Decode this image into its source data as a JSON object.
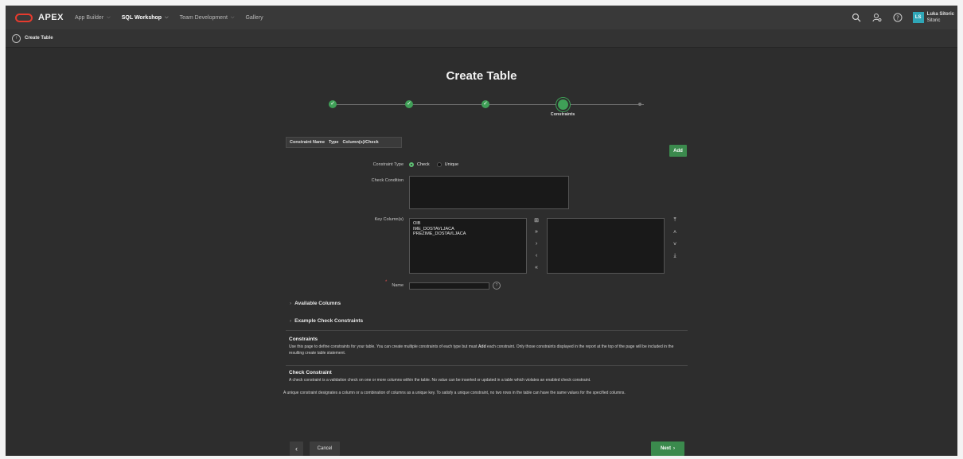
{
  "header": {
    "logo": "APEX",
    "nav": [
      {
        "label": "App Builder",
        "has_menu": true
      },
      {
        "label": "SQL Workshop",
        "has_menu": true
      },
      {
        "label": "Team Development",
        "has_menu": true
      },
      {
        "label": "Gallery",
        "has_menu": false
      }
    ],
    "icons": [
      "search-icon",
      "administration-icon",
      "help-icon"
    ],
    "user": {
      "initials": "LS",
      "first": "Luka Sitoric",
      "second": "Sitoric"
    }
  },
  "breadcrumb": {
    "label": "Create Table"
  },
  "page_title": "Create Table",
  "wizard": {
    "steps_done": 3,
    "current_label": "Constraints"
  },
  "report": {
    "columns": [
      "Constraint Name",
      "Type",
      "Column(s)/Check"
    ]
  },
  "buttons": {
    "add": "Add",
    "cancel": "Cancel",
    "next": "Next",
    "prev_icon": "‹",
    "next_icon": "›"
  },
  "form": {
    "constraint_type_label": "Constraint Type",
    "constraint_type_options": [
      "Check",
      "Unique"
    ],
    "constraint_type_selected": "Check",
    "check_condition_label": "Check Condition",
    "check_condition_value": "",
    "key_columns_label": "Key Column(s)",
    "available_columns": [
      "OIB",
      "IME_DOSTAVLJACA",
      "PREZIME_DOSTAVLJACA"
    ],
    "selected_columns": [],
    "name_label": "Name",
    "name_value": ""
  },
  "sections": {
    "available_columns": "Available Columns",
    "example_check": "Example Check Constraints"
  },
  "help": {
    "constraints_title": "Constraints",
    "constraints_text_before": "Use this page to define constraints for your table. You can create multiple constraints of each type but must ",
    "constraints_text_bold": "Add",
    "constraints_text_after": " each constraint. Only those constraints displayed in the report at the top of the page will be included in the resulting create table statement.",
    "check_title": "Check Constraint",
    "check_text": "A check constraint is a validation check on one or more columns within the table. No value can be inserted or updated in a table which violates an enabled check constraint.",
    "unique_text": "A unique constraint designates a column or a combination of columns as a unique key. To satisfy a unique constraint, no two rows in the table can have the same values for the specified columns."
  }
}
